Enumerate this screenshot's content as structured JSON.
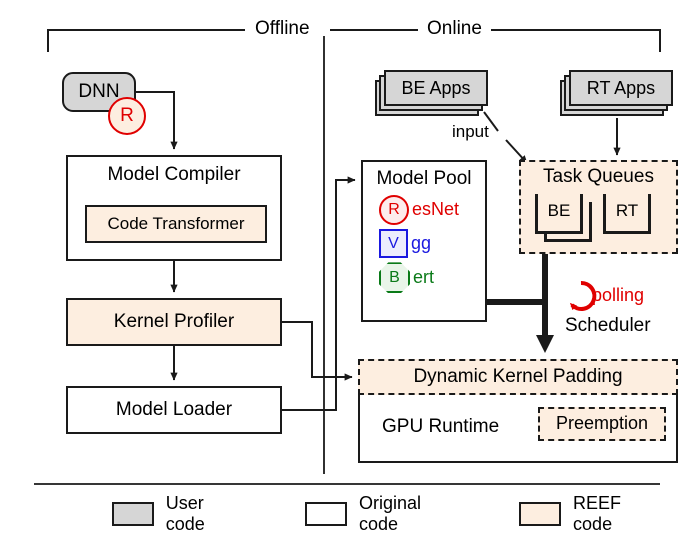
{
  "figure": {
    "sections": {
      "offline": "Offline",
      "online": "Online"
    }
  },
  "offline": {
    "dnn": {
      "label": "DNN",
      "badge": "R"
    },
    "model_compiler": {
      "label": "Model Compiler",
      "inner": "Code Transformer"
    },
    "kernel_profiler": {
      "label": "Kernel Profiler"
    },
    "model_loader": {
      "label": "Model Loader"
    }
  },
  "online": {
    "be_apps": {
      "label": "BE Apps"
    },
    "rt_apps": {
      "label": "RT Apps"
    },
    "input_label": "input",
    "model_pool": {
      "title": "Model Pool",
      "models": [
        {
          "icon": "R",
          "icon_shape": "circle",
          "label": "esNet",
          "color": "#e00000"
        },
        {
          "icon": "V",
          "icon_shape": "square",
          "label": "gg",
          "color": "#1a18e0"
        },
        {
          "icon": "B",
          "icon_shape": "octagon",
          "label": "ert",
          "color": "#0a7a18"
        }
      ]
    },
    "task_queues": {
      "title": "Task Queues",
      "queues": [
        "BE",
        "RT"
      ]
    },
    "scheduler": {
      "label": "Scheduler",
      "polling_label": "polling"
    },
    "gpu_runtime": {
      "dynamic_kernel_padding": "Dynamic Kernel Padding",
      "label": "GPU Runtime",
      "preemption": "Preemption"
    }
  },
  "legend": {
    "items": [
      {
        "label": "User code",
        "swatch": "#d6d6d6"
      },
      {
        "label": "Original code",
        "swatch": "#ffffff"
      },
      {
        "label": "REEF code",
        "swatch": "#fdeee0"
      }
    ]
  },
  "colors": {
    "user_code": "#d6d6d6",
    "reef_code": "#fdeee0",
    "original_code": "#ffffff",
    "outline": "#1a1a1a",
    "red": "#e00000",
    "blue": "#1a18e0",
    "green": "#0a7a18"
  }
}
